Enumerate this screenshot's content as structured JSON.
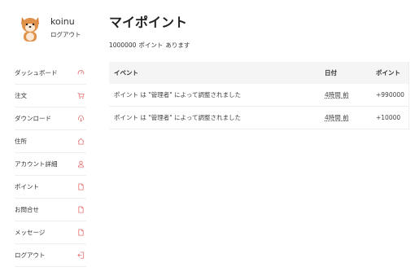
{
  "user": {
    "name": "koinu",
    "logout_label": "ログアウト",
    "avatar_icon": "shiba-dog-avatar"
  },
  "sidebar": {
    "items": [
      {
        "label": "ダッシュボード",
        "icon": "dashboard-icon"
      },
      {
        "label": "注文",
        "icon": "cart-icon"
      },
      {
        "label": "ダウンロード",
        "icon": "cloud-download-icon"
      },
      {
        "label": "住所",
        "icon": "home-icon"
      },
      {
        "label": "アカウント詳細",
        "icon": "user-icon"
      },
      {
        "label": "ポイント",
        "icon": "document-icon"
      },
      {
        "label": "お問合せ",
        "icon": "document-icon"
      },
      {
        "label": "メッセージ",
        "icon": "document-icon"
      },
      {
        "label": "ログアウト",
        "icon": "logout-icon"
      }
    ],
    "icon_color": "#e57373"
  },
  "main": {
    "title": "マイポイント",
    "summary": {
      "points": "1000000",
      "unit": "ポイント",
      "suffix": "あります"
    },
    "table": {
      "headers": [
        "イベント",
        "日付",
        "ポイント"
      ],
      "rows": [
        {
          "event": "ポイント は \"管理者\" によって調整されました",
          "date": "4時間 前",
          "points": "+990000"
        },
        {
          "event": "ポイント は \"管理者\" によって調整されました",
          "date": "4時間 前",
          "points": "+10000"
        }
      ]
    }
  }
}
